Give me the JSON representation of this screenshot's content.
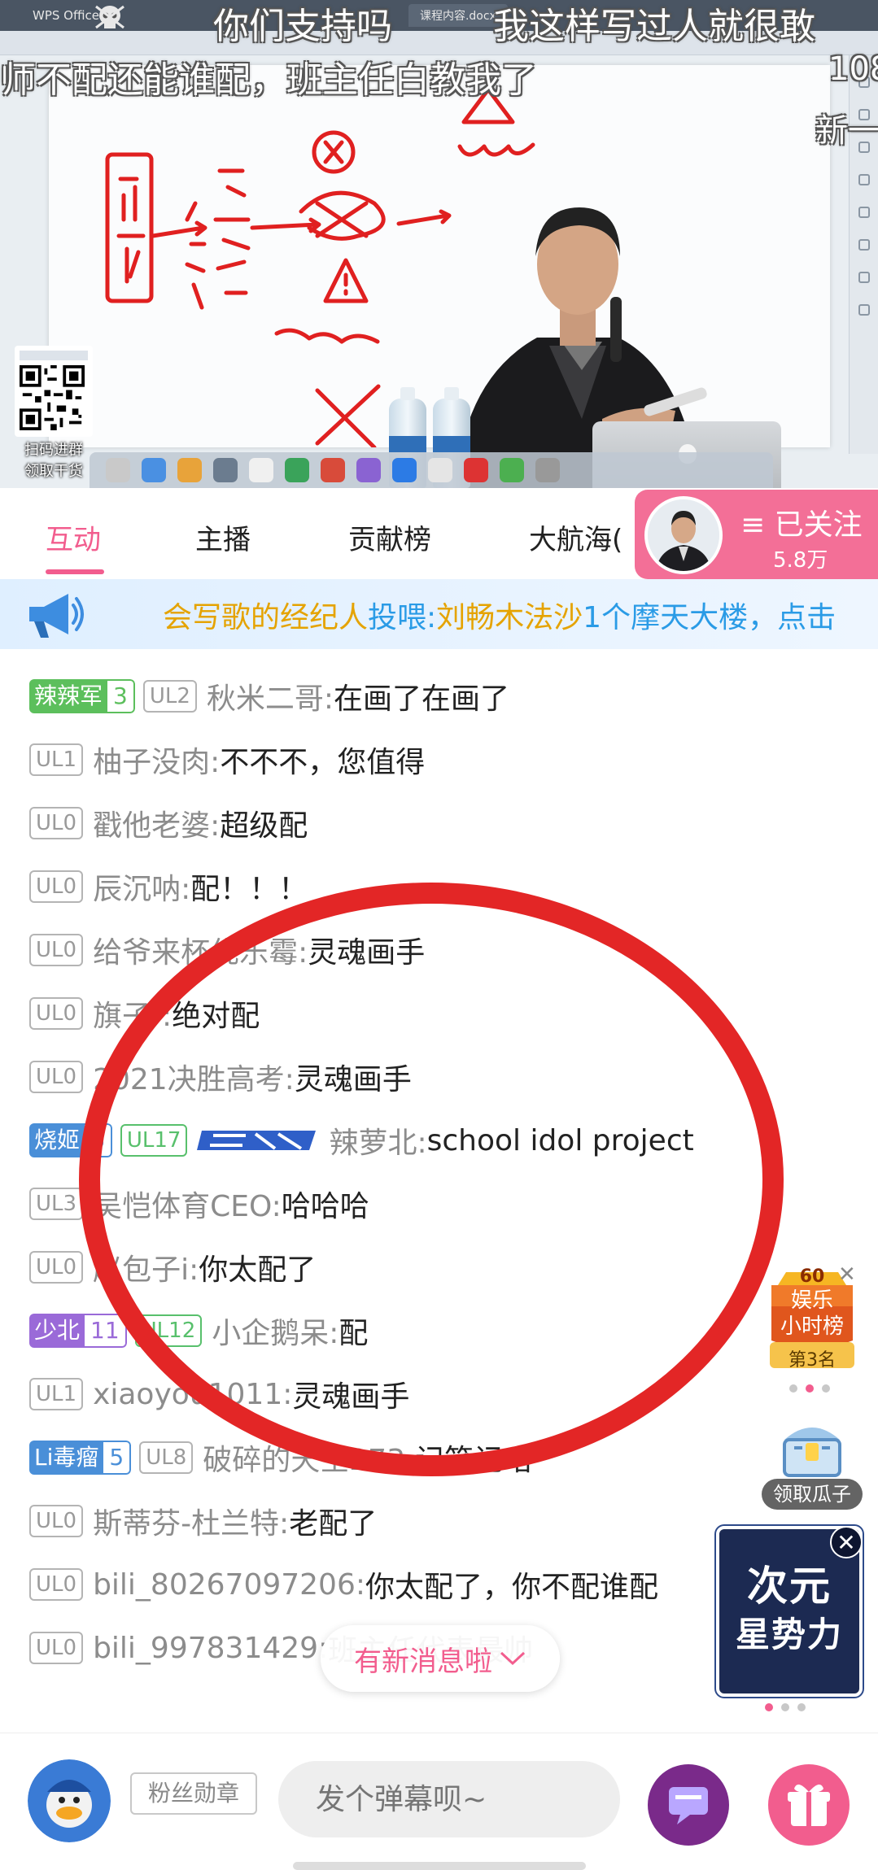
{
  "video": {
    "app_name": "WPS Office",
    "doc_tab": "课程内容.docx",
    "qr_caption": [
      "扫码进群",
      "领取干货"
    ],
    "danmaku": [
      "你们支持吗",
      "我这样写过人就很敢",
      "师不配还能谁配，班主任白教我了",
      "108",
      "新一"
    ]
  },
  "tabs": [
    "互动",
    "主播",
    "贡献榜",
    "大航海("
  ],
  "active_tab": 0,
  "follow": {
    "label": "≡ 已关注",
    "count": "5.8万"
  },
  "banner": {
    "user": "会写歌的经纪人",
    "verb": "投喂:",
    "target": "刘畅木法沙",
    "gift": "1个摩天大楼，点击"
  },
  "chat_messages": [
    {
      "fan": "辣辣军",
      "fan_level": "3",
      "fan_color": "#5cbf5c",
      "ul": "UL2",
      "user": "秋米二哥:",
      "text": "在画了在画了"
    },
    {
      "ul": "UL1",
      "user": "柚子没肉:",
      "text": "不不不，您值得"
    },
    {
      "ul": "UL0",
      "user": "戳他老婆:",
      "text": "超级配"
    },
    {
      "ul": "UL0",
      "user": "辰沉呐:",
      "text": "配！！！"
    },
    {
      "ul": "UL0",
      "user": "给爷来杯优乐霉:",
      "text": "灵魂画手"
    },
    {
      "ul": "UL0",
      "user": "旗子-:",
      "text": "绝对配"
    },
    {
      "ul": "UL0",
      "user": "2021决胜高考:",
      "text": "灵魂画手"
    },
    {
      "fan": "烧姬",
      "fan_level": "6",
      "fan_color": "#4a8fd8",
      "ul": "UL17",
      "ul_green": true,
      "guard": true,
      "user": "辣萝北:",
      "text": "school idol project"
    },
    {
      "ul": "UL3",
      "user": "吴恺体育CEO:",
      "text": "哈哈哈"
    },
    {
      "ul": "UL0",
      "user": "赵包子i:",
      "text": "你太配了"
    },
    {
      "fan": "少北",
      "fan_level": "11",
      "fan_color": "#9a6ad8",
      "ul": "UL12",
      "ul_green": true,
      "user": "小企鹅呆:",
      "text": "配"
    },
    {
      "ul": "UL1",
      "user": "xiaoyou1011:",
      "text": "灵魂画手"
    },
    {
      "fan": "Li毒瘤",
      "fan_level": "5",
      "fan_color": "#4a8fd8",
      "ul": "UL8",
      "user": "破碎的天空273:",
      "text": "记笔记咯"
    },
    {
      "ul": "UL0",
      "user": "斯蒂芬-杜兰特:",
      "text": "老配了"
    },
    {
      "ul": "UL0",
      "user": "bili_80267097206:",
      "text": "你太配了，你不配谁配"
    },
    {
      "ul": "UL0",
      "user": "bili_997831429:",
      "text": "班主任代表最帅"
    }
  ],
  "new_messages_label": "有新消息啦",
  "rank_widget": {
    "title": [
      "娱乐",
      "小时榜"
    ],
    "place": "第3名",
    "badge_number": "60"
  },
  "chest_widget": {
    "label": "领取瓜子"
  },
  "promo": {
    "line1": "次元",
    "line2": "星势力"
  },
  "bottom": {
    "fan_medal": "粉丝勋章",
    "input_placeholder": "发个弹幕呗~"
  },
  "colors": {
    "accent": "#f25d8e",
    "circle": "#e32626"
  }
}
